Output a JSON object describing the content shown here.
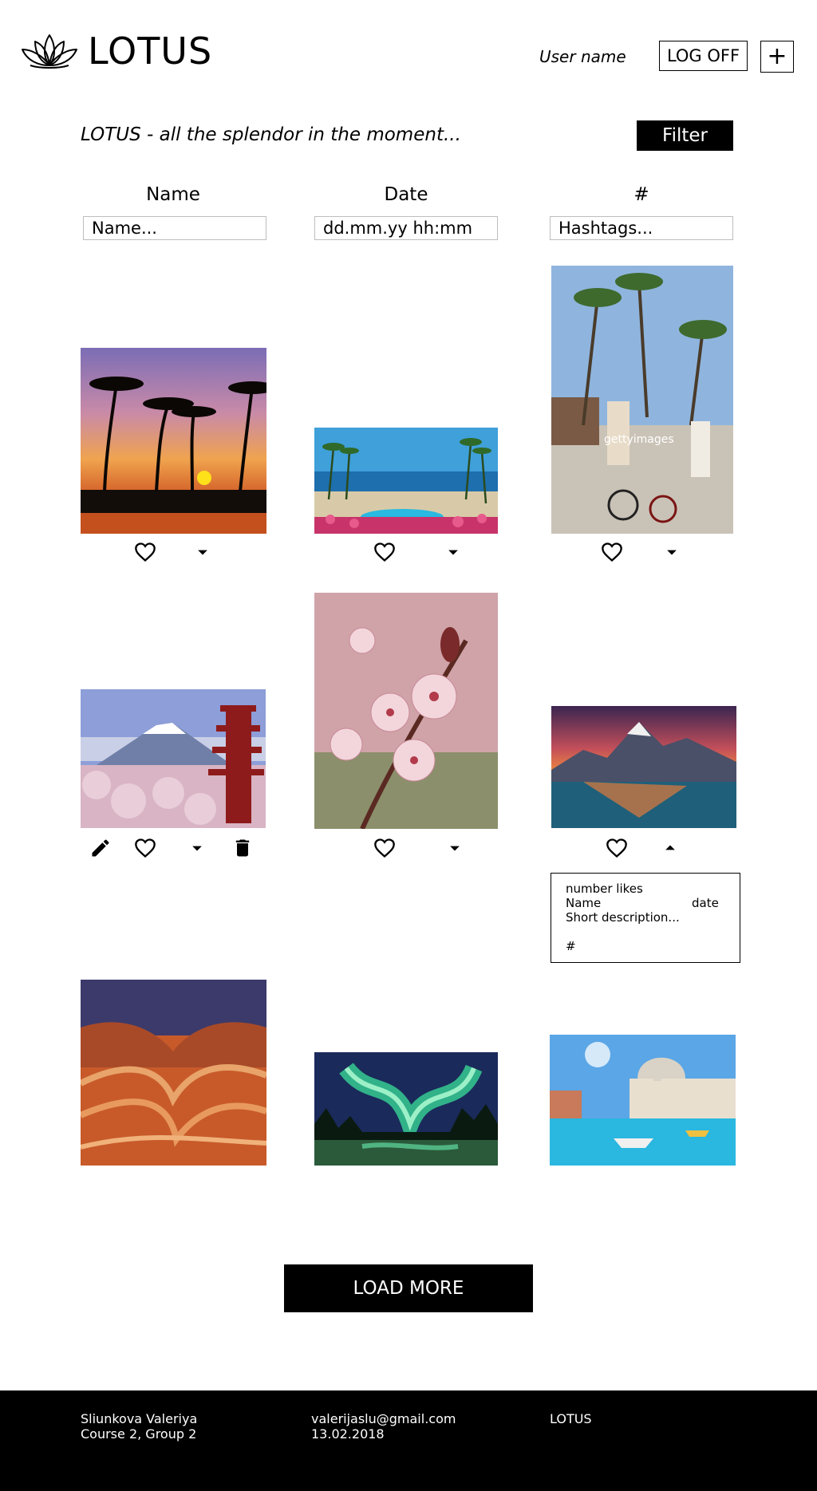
{
  "header": {
    "brand": "LOTUS",
    "user_name": "User name",
    "log_off": "LOG OFF",
    "add": "+"
  },
  "toolbar": {
    "tagline": "LOTUS - all the splendor in the moment...",
    "filter": "Filter"
  },
  "filters": {
    "name": {
      "label": "Name",
      "placeholder": "Name..."
    },
    "date": {
      "label": "Date",
      "placeholder": "dd.mm.yy hh:mm"
    },
    "hashtag": {
      "label": "#",
      "placeholder": "Hashtags..."
    }
  },
  "photos": [
    {
      "subject": "palm-sunset"
    },
    {
      "subject": "tropical-resort-pool"
    },
    {
      "subject": "cyclists-palm-boardwalk",
      "watermark": "gettyimages"
    },
    {
      "subject": "mount-fuji-pagoda"
    },
    {
      "subject": "cherry-blossom"
    },
    {
      "subject": "mountain-lake-dusk"
    },
    {
      "subject": "sandstone-wave"
    },
    {
      "subject": "northern-lights"
    },
    {
      "subject": "venice-grand-canal"
    }
  ],
  "info_card": {
    "likes": "number likes",
    "name": "Name",
    "date": "date",
    "description": "Short description...",
    "hashtags": "#"
  },
  "load_more": "LOAD MORE",
  "footer": {
    "author": "Sliunkova Valeriya",
    "group": "Course 2, Group 2",
    "email": "valerijaslu@gmail.com",
    "date": "13.02.2018",
    "brand": "LOTUS"
  },
  "icons": [
    "lotus-icon",
    "heart-icon",
    "caret-down-icon",
    "caret-up-icon",
    "pencil-icon",
    "trash-icon"
  ]
}
